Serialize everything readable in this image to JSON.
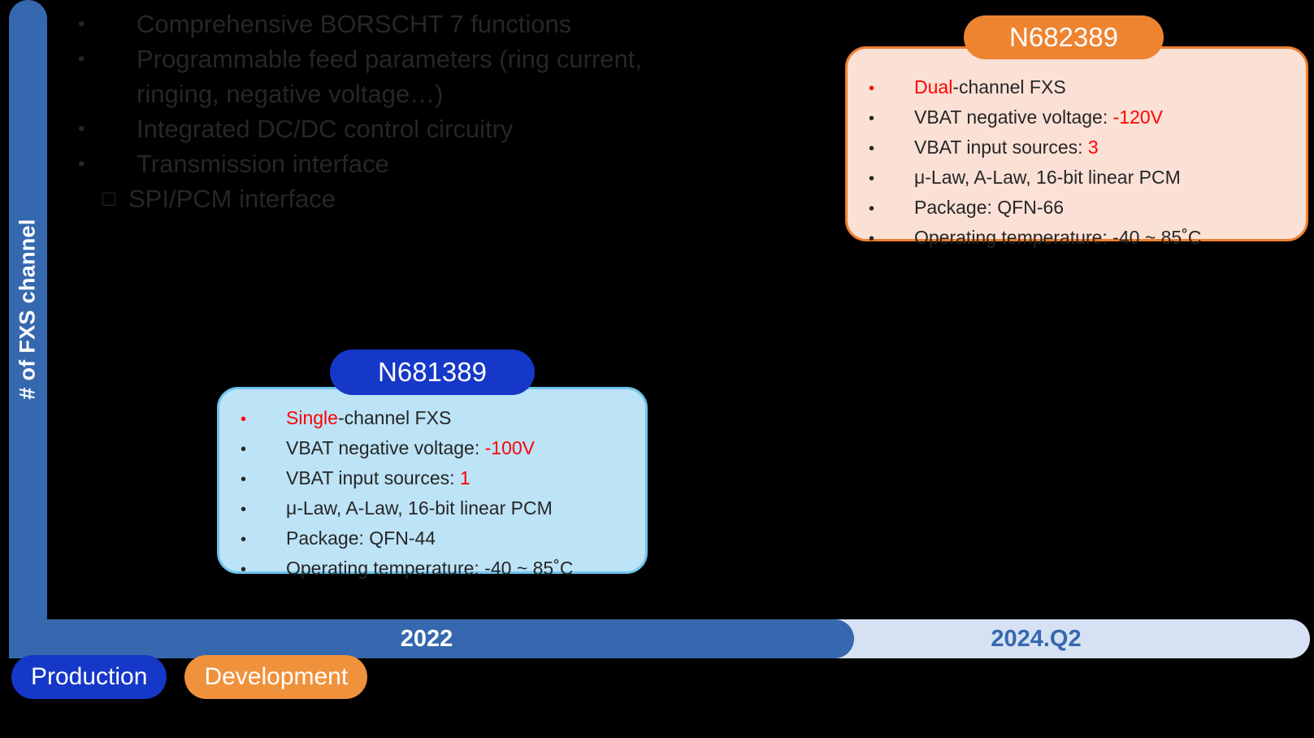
{
  "axis": {
    "y_label": "# of FXS channel"
  },
  "timeline": {
    "current_label": "2022",
    "future_label": "2024.Q2",
    "current_color": "#3568AE",
    "future_color": "#D6E2F3"
  },
  "features": {
    "bullet_glyph": "•",
    "sub_bullet_glyph": "□",
    "items": [
      {
        "text": "Comprehensive BORSCHT 7 functions"
      },
      {
        "text": "Programmable feed parameters (ring current, ringing, negative voltage…)"
      },
      {
        "text": "Integrated DC/DC control circuitry"
      },
      {
        "text": "Transmission interface"
      }
    ],
    "sub_item": "SPI/PCM interface"
  },
  "cards": [
    {
      "id": "n681389",
      "title": "N681389",
      "title_color": "#1538C8",
      "fill_color": "#BDE3F7",
      "border_color": "#6FC4EE",
      "specs": [
        {
          "bullet_accent": true,
          "prefix": "",
          "accent": "Single",
          "suffix": "-channel FXS"
        },
        {
          "bullet_accent": false,
          "prefix": "VBAT negative voltage: ",
          "accent": "-100V",
          "suffix": ""
        },
        {
          "bullet_accent": false,
          "prefix": "VBAT input sources: ",
          "accent": "1",
          "suffix": ""
        },
        {
          "bullet_accent": false,
          "prefix": "μ-Law, A-Law, 16-bit linear PCM",
          "accent": "",
          "suffix": ""
        },
        {
          "bullet_accent": false,
          "prefix": "Package: QFN-44",
          "accent": "",
          "suffix": ""
        },
        {
          "bullet_accent": false,
          "prefix": "Operating temperature: -40 ~ 85˚C",
          "accent": "",
          "suffix": ""
        }
      ]
    },
    {
      "id": "n682389",
      "title": "N682389",
      "title_color": "#EE8330",
      "fill_color": "#FBE0D5",
      "border_color": "#F08030",
      "specs": [
        {
          "bullet_accent": true,
          "prefix": "",
          "accent": "Dual",
          "suffix": "-channel FXS"
        },
        {
          "bullet_accent": false,
          "prefix": "VBAT negative voltage: ",
          "accent": "-120V",
          "suffix": ""
        },
        {
          "bullet_accent": false,
          "prefix": "VBAT input sources: ",
          "accent": "3",
          "suffix": ""
        },
        {
          "bullet_accent": false,
          "prefix": "μ-Law, A-Law, 16-bit linear PCM",
          "accent": "",
          "suffix": ""
        },
        {
          "bullet_accent": false,
          "prefix": "Package: QFN-66",
          "accent": "",
          "suffix": ""
        },
        {
          "bullet_accent": false,
          "prefix": "Operating temperature: -40 ~ 85˚C",
          "accent": "",
          "suffix": ""
        }
      ]
    }
  ],
  "legend": {
    "production_label": "Production",
    "production_color": "#1538C8",
    "development_label": "Development",
    "development_color": "#F0923C"
  },
  "colors": {
    "accent_red": "#FF0000",
    "text_dark": "#262626",
    "background": "#000000"
  }
}
